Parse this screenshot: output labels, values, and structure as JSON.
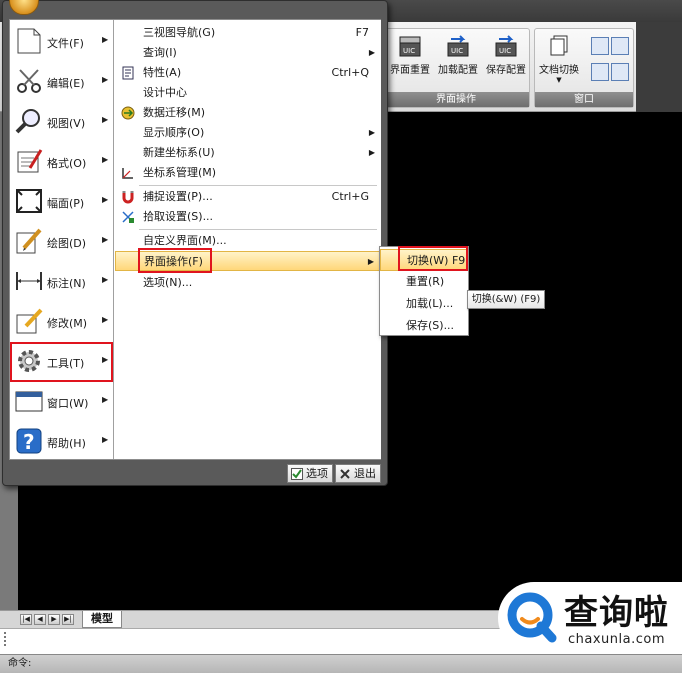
{
  "ribbon": {
    "group_interface": {
      "label": "界面操作",
      "buttons": [
        {
          "label": "界面重置",
          "icon": "uic-reset-icon"
        },
        {
          "label": "加载配置",
          "icon": "uic-load-icon"
        },
        {
          "label": "保存配置",
          "icon": "uic-save-icon"
        }
      ]
    },
    "group_window": {
      "label": "窗口",
      "doc_switch": "文档切换"
    }
  },
  "app_menu": {
    "left_items": [
      {
        "label": "文件(F)",
        "icon": "file-icon"
      },
      {
        "label": "编辑(E)",
        "icon": "scissors-icon"
      },
      {
        "label": "视图(V)",
        "icon": "magnifier-icon"
      },
      {
        "label": "格式(O)",
        "icon": "format-icon"
      },
      {
        "label": "幅面(P)",
        "icon": "frame-icon"
      },
      {
        "label": "绘图(D)",
        "icon": "draw-icon"
      },
      {
        "label": "标注(N)",
        "icon": "dimension-icon"
      },
      {
        "label": "修改(M)",
        "icon": "modify-icon"
      },
      {
        "label": "工具(T)",
        "icon": "gear-icon"
      },
      {
        "label": "窗口(W)",
        "icon": "window-icon"
      },
      {
        "label": "帮助(H)",
        "icon": "help-icon"
      }
    ],
    "tools_submenu": [
      {
        "label": "三视图导航(G)",
        "shortcut": "F7"
      },
      {
        "label": "查询(I)",
        "arrow": true
      },
      {
        "label": "特性(A)",
        "shortcut": "Ctrl+Q",
        "icon": "properties-icon"
      },
      {
        "label": "设计中心"
      },
      {
        "label": "数据迁移(M)",
        "icon": "data-migrate-icon"
      },
      {
        "label": "显示顺序(O)",
        "arrow": true
      },
      {
        "label": "新建坐标系(U)",
        "arrow": true
      },
      {
        "label": "坐标系管理(M)",
        "icon": "ucs-icon"
      },
      {
        "label": "捕捉设置(P)...",
        "shortcut": "Ctrl+G",
        "icon": "magnet-icon"
      },
      {
        "label": "拾取设置(S)...",
        "icon": "pick-icon"
      },
      {
        "label": "自定义界面(M)..."
      },
      {
        "label": "界面操作(F)",
        "arrow": true
      },
      {
        "label": "选项(N)..."
      }
    ],
    "footer": {
      "options": "选项",
      "exit": "退出"
    }
  },
  "interface_submenu": [
    {
      "label": "切换(W) F9"
    },
    {
      "label": "重置(R)"
    },
    {
      "label": "加载(L)..."
    },
    {
      "label": "保存(S)..."
    }
  ],
  "tooltip": "切换(&W) (F9)",
  "bottom": {
    "model_tab": "模型",
    "command_prompt": "命令:"
  },
  "watermark": {
    "title": "查询啦",
    "url": "chaxunla.com"
  },
  "colors": {
    "highlight_red": "#e0141e",
    "menu_hover": "#ffd77a",
    "watermark_blue": "#1e78d6"
  }
}
